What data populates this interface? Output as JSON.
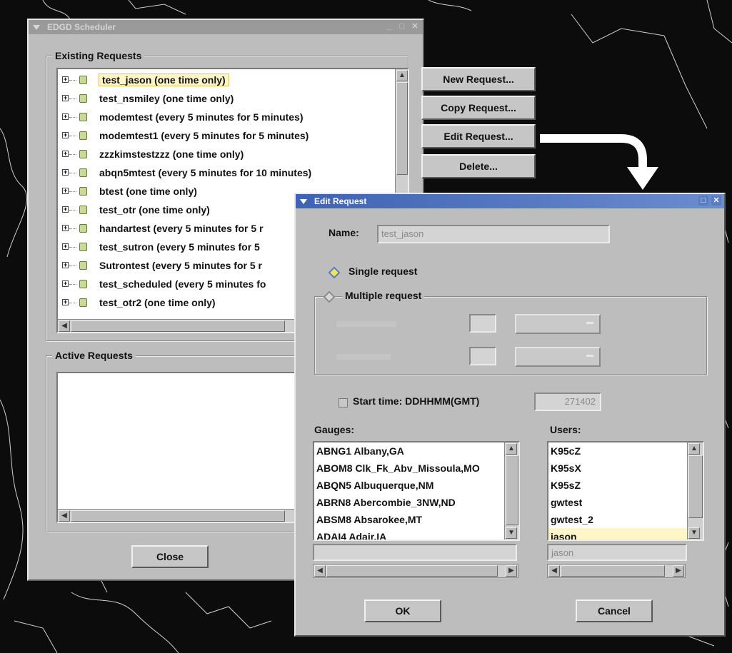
{
  "main_window": {
    "title": "EDGD Scheduler",
    "existing_group_label": "Existing Requests",
    "existing_requests": [
      "test_jason (one time only)",
      "test_nsmiley (one time only)",
      "modemtest (every 5 minutes for 5 minutes)",
      "modemtest1 (every 5 minutes for 5 minutes)",
      "zzzkimstestzzz (one time only)",
      "abqn5mtest (every 5 minutes for 10 minutes)",
      "btest (one time only)",
      "test_otr (one time only)",
      "handartest (every 5 minutes for 5 r",
      "test_sutron (every 5 minutes for 5",
      "Sutrontest (every 5 minutes for 5 r",
      "test_scheduled (every 5 minutes fo",
      "test_otr2 (one time only)"
    ],
    "buttons": {
      "new": "New Request...",
      "copy": "Copy Request...",
      "edit": "Edit Request...",
      "delete": "Delete..."
    },
    "active_group_label": "Active Requests",
    "close_label": "Close"
  },
  "edit_dialog": {
    "title": "Edit Request",
    "name_label": "Name:",
    "name_value": "test_jason",
    "single_label": "Single request",
    "multiple_label": "Multiple request",
    "start_time_label": "Start time: DDHHMM(GMT)",
    "start_time_value": "271402",
    "gauges_label": "Gauges:",
    "gauges": [
      "ABNG1 Albany,GA",
      "ABOM8 Clk_Fk_Abv_Missoula,MO",
      "ABQN5 Albuquerque,NM",
      "ABRN8 Abercombie_3NW,ND",
      "ABSM8 Absarokee,MT",
      "ADAI4 Adair,IA"
    ],
    "users_label": "Users:",
    "users": [
      "K95cZ",
      "K95sX",
      "K95sZ",
      "gwtest",
      "gwtest_2",
      "jason"
    ],
    "selected_user": "jason",
    "ok_label": "OK",
    "cancel_label": "Cancel"
  },
  "colors": {
    "accent": "#3f63b4",
    "selection": "#fff6c8",
    "window_bg": "#bdbdbd"
  },
  "icons": {
    "window_menu": "window-menu-icon",
    "maximize": "maximize-icon",
    "close": "close-icon",
    "tree_expand": "plus-box-icon",
    "tree_node": "folder-node-icon",
    "arrow": "curved-arrow-icon"
  }
}
